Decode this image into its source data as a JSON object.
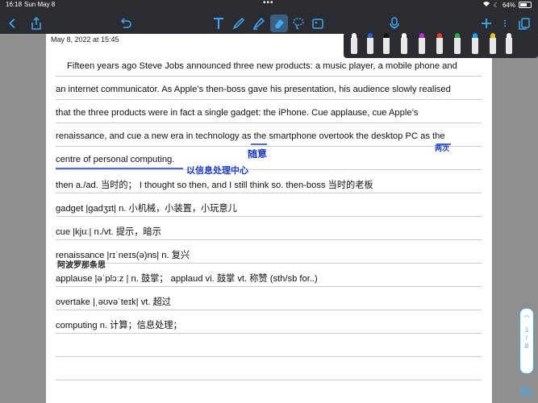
{
  "status": {
    "time": "16:18",
    "date": "Sun May 8",
    "battery": "64%"
  },
  "toolbar": {
    "icons": [
      "chevron-left-icon",
      "share-icon",
      "undo-icon",
      "text-tool-icon",
      "pen-tool-icon",
      "highlighter-icon",
      "eraser-icon",
      "lasso-icon",
      "image-icon",
      "microphone-icon",
      "add-icon",
      "more-icon",
      "pages-icon"
    ],
    "accent": "#3fa9f5"
  },
  "page": {
    "date": "May 8, 2022 at 15:45",
    "lines": [
      "Fifteen years ago Steve Jobs announced three new products: a music player, a mobile phone and",
      "an internet communicator. As Apple’s then-boss gave his presentation, his audience slowly realised",
      "that the three products were in fact a single gadget: the iPhone. Cue applause, cue Apple’s",
      "renaissance, and cue a new era in technology as the smartphone overtook the desktop PC as the",
      "centre of personal computing.",
      "then a./ad. 当时的；   I thought so then, and I still think so. then-boss 当时的老板",
      "gadget |ɡadʒɪt|  n. 小机械，小装置，小玩意儿",
      "cue |kjuː| n./vt. 提示，暗示",
      "renaissance  |rɪˈneɪs(ə)ns|  n. 复兴",
      "applause |əˈplɔːz | n. 鼓掌；    applaud vi. 鼓掌  vt. 称赞  (sth/sb for..)",
      "overtake |ˌəʊvəˈteɪk|  vt. 超过",
      "computing n. 计算；信息处理；"
    ],
    "handwriting": {
      "note1": "以信息处理中心",
      "note2": "随意",
      "note3": "两次",
      "note4": "阿波罗那条思"
    }
  },
  "pens": [
    "#ffffff",
    "#2b5fd9",
    "#111111",
    "#ffffff",
    "#c02ad0",
    "#e23b2e",
    "#2fa84f",
    "#1aa6e8",
    "#e8c020",
    "#f0f0f0"
  ],
  "pager": {
    "current": "1",
    "total": "8"
  }
}
